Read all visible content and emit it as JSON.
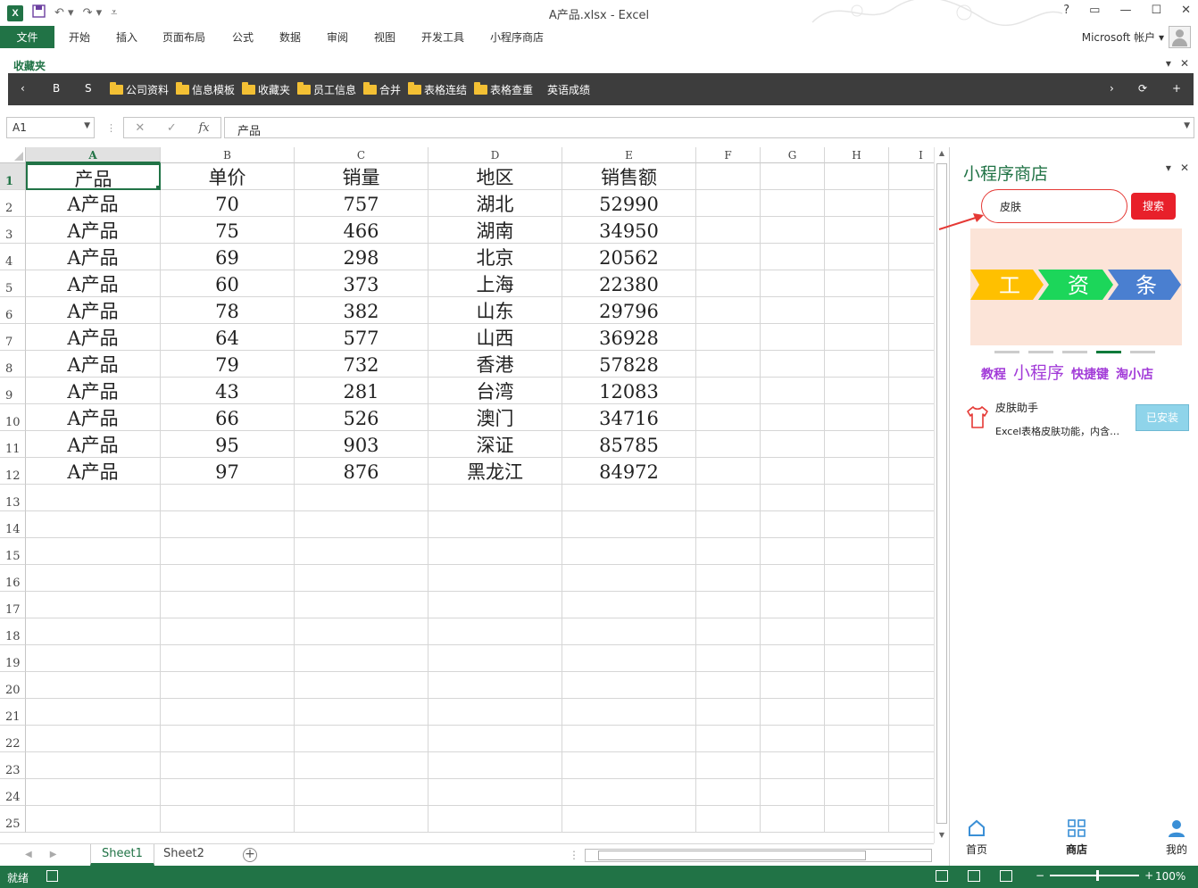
{
  "window": {
    "title": "A产品.xlsx - Excel",
    "controls": [
      "?",
      "▭",
      "—",
      "☐",
      "✕"
    ]
  },
  "qat": {
    "logo": "X"
  },
  "ribbon": {
    "tabs": [
      "文件",
      "开始",
      "插入",
      "页面布局",
      "公式",
      "数据",
      "审阅",
      "视图",
      "开发工具",
      "小程序商店"
    ],
    "account": "Microsoft 帐户"
  },
  "favorites": {
    "label": "收藏夹",
    "items": [
      {
        "label": "B",
        "folder": false
      },
      {
        "label": "S",
        "folder": false
      },
      {
        "label": "公司资料",
        "folder": true
      },
      {
        "label": "信息模板",
        "folder": true
      },
      {
        "label": "收藏夹",
        "folder": true
      },
      {
        "label": "员工信息",
        "folder": true
      },
      {
        "label": "合并",
        "folder": true
      },
      {
        "label": "表格连结",
        "folder": true
      },
      {
        "label": "表格查重",
        "folder": true
      },
      {
        "label": "英语成绩",
        "folder": false
      }
    ]
  },
  "formula_bar": {
    "name_box": "A1",
    "cancel": "✕",
    "enter": "✓",
    "fx": "fx",
    "content": "产品"
  },
  "grid": {
    "columns": [
      "A",
      "B",
      "C",
      "D",
      "E",
      "F",
      "G",
      "H",
      "I"
    ],
    "selected_column": "A",
    "selected_row": 1,
    "row_numbers": [
      "1",
      "2",
      "3",
      "4",
      "5",
      "6",
      "7",
      "8",
      "9",
      "10",
      "11",
      "12",
      "13",
      "14",
      "15",
      "16",
      "17",
      "18",
      "19",
      "20",
      "21",
      "22",
      "23",
      "24",
      "25"
    ],
    "rows": [
      [
        "产品",
        "单价",
        "销量",
        "地区",
        "销售额"
      ],
      [
        "A产品",
        "70",
        "757",
        "湖北",
        "52990"
      ],
      [
        "A产品",
        "75",
        "466",
        "湖南",
        "34950"
      ],
      [
        "A产品",
        "69",
        "298",
        "北京",
        "20562"
      ],
      [
        "A产品",
        "60",
        "373",
        "上海",
        "22380"
      ],
      [
        "A产品",
        "78",
        "382",
        "山东",
        "29796"
      ],
      [
        "A产品",
        "64",
        "577",
        "山西",
        "36928"
      ],
      [
        "A产品",
        "79",
        "732",
        "香港",
        "57828"
      ],
      [
        "A产品",
        "43",
        "281",
        "台湾",
        "12083"
      ],
      [
        "A产品",
        "66",
        "526",
        "澳门",
        "34716"
      ],
      [
        "A产品",
        "95",
        "903",
        "深证",
        "85785"
      ],
      [
        "A产品",
        "97",
        "876",
        "黑龙江",
        "84972"
      ]
    ]
  },
  "sheets": {
    "tabs": [
      "Sheet1",
      "Sheet2"
    ],
    "active": "Sheet1",
    "add": "+"
  },
  "status": {
    "ready": "就绪",
    "zoom": "100%"
  },
  "panel": {
    "title": "小程序商店",
    "search_value": "皮肤",
    "search_button": "搜索",
    "banner_chars": [
      "工",
      "资",
      "条"
    ],
    "banner_colors": [
      "#ffc000",
      "#1cd65a",
      "#4a7fd0"
    ],
    "carousel_active_index": 3,
    "carousel_count": 5,
    "links": [
      "教程",
      "小程序",
      "快捷键",
      "淘小店"
    ],
    "plugin": {
      "name": "皮肤助手",
      "description": "Excel表格皮肤功能，内含…",
      "button": "已安装"
    },
    "nav": [
      {
        "label": "首页",
        "icon": "home-icon"
      },
      {
        "label": "商店",
        "icon": "grid-icon"
      },
      {
        "label": "我的",
        "icon": "user-icon"
      }
    ],
    "accent": "#217346"
  }
}
